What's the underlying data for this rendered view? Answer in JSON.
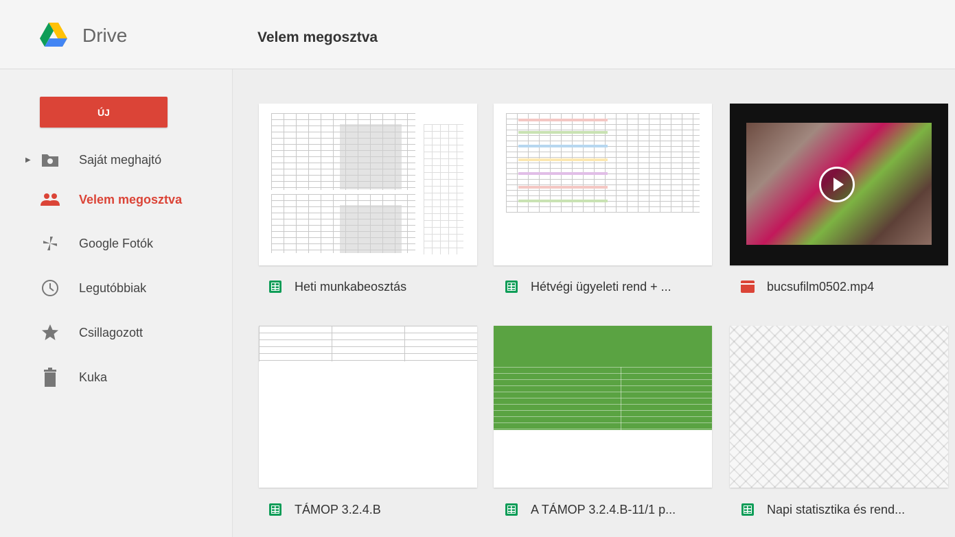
{
  "header": {
    "app_name": "Drive",
    "page_title": "Velem megosztva"
  },
  "sidebar": {
    "new_button": "ÚJ",
    "items": [
      {
        "label": "Saját meghajtó",
        "icon": "drive-folder-icon"
      },
      {
        "label": "Velem megosztva",
        "icon": "people-icon"
      },
      {
        "label": "Google Fotók",
        "icon": "pinwheel-icon"
      },
      {
        "label": "Legutóbbiak",
        "icon": "clock-icon"
      },
      {
        "label": "Csillagozott",
        "icon": "star-icon"
      },
      {
        "label": "Kuka",
        "icon": "trash-icon"
      }
    ]
  },
  "files": [
    {
      "name": "Heti munkabeosztás",
      "type": "spreadsheet"
    },
    {
      "name": "Hétvégi ügyeleti rend + ...",
      "type": "spreadsheet"
    },
    {
      "name": "bucsufilm0502.mp4",
      "type": "video"
    },
    {
      "name": "TÁMOP 3.2.4.B",
      "type": "spreadsheet"
    },
    {
      "name": "A TÁMOP 3.2.4.B-11/1 p...",
      "type": "spreadsheet"
    },
    {
      "name": "Napi statisztika és rend...",
      "type": "spreadsheet"
    }
  ],
  "colors": {
    "accent": "#db4437",
    "sheets": "#0f9d58"
  }
}
